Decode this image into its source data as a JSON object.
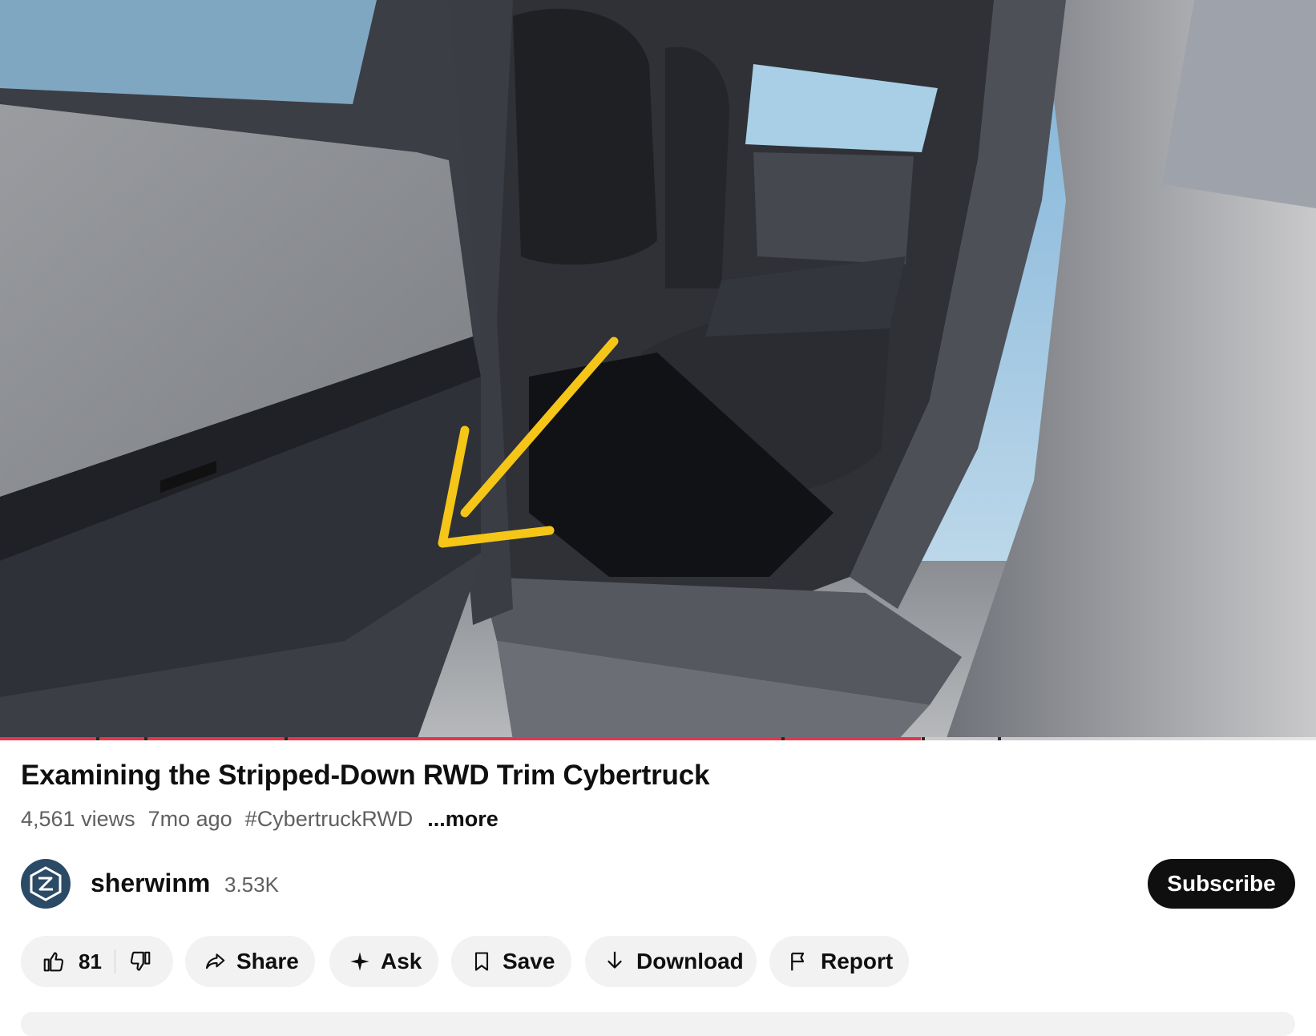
{
  "video": {
    "progress_fraction": 0.7,
    "buffered_fraction": 0.08
  },
  "title": "Examining the Stripped-Down RWD Trim Cybertruck",
  "meta": {
    "views": "4,561 views",
    "age": "7mo ago",
    "hashtag": "#CybertruckRWD",
    "more": "...more"
  },
  "channel": {
    "name": "sherwinm",
    "subscribers": "3.53K",
    "avatar_icon": "channel-logo-icon",
    "subscribe_label": "Subscribe"
  },
  "actions": {
    "like_count": "81",
    "share": "Share",
    "ask": "Ask",
    "save": "Save",
    "download": "Download",
    "report": "Report"
  },
  "colors": {
    "progress": "#e8344e",
    "subscribe_bg": "#0f0f0f",
    "pill_bg": "#f2f2f2",
    "arrow_annotation": "#f5c518"
  }
}
